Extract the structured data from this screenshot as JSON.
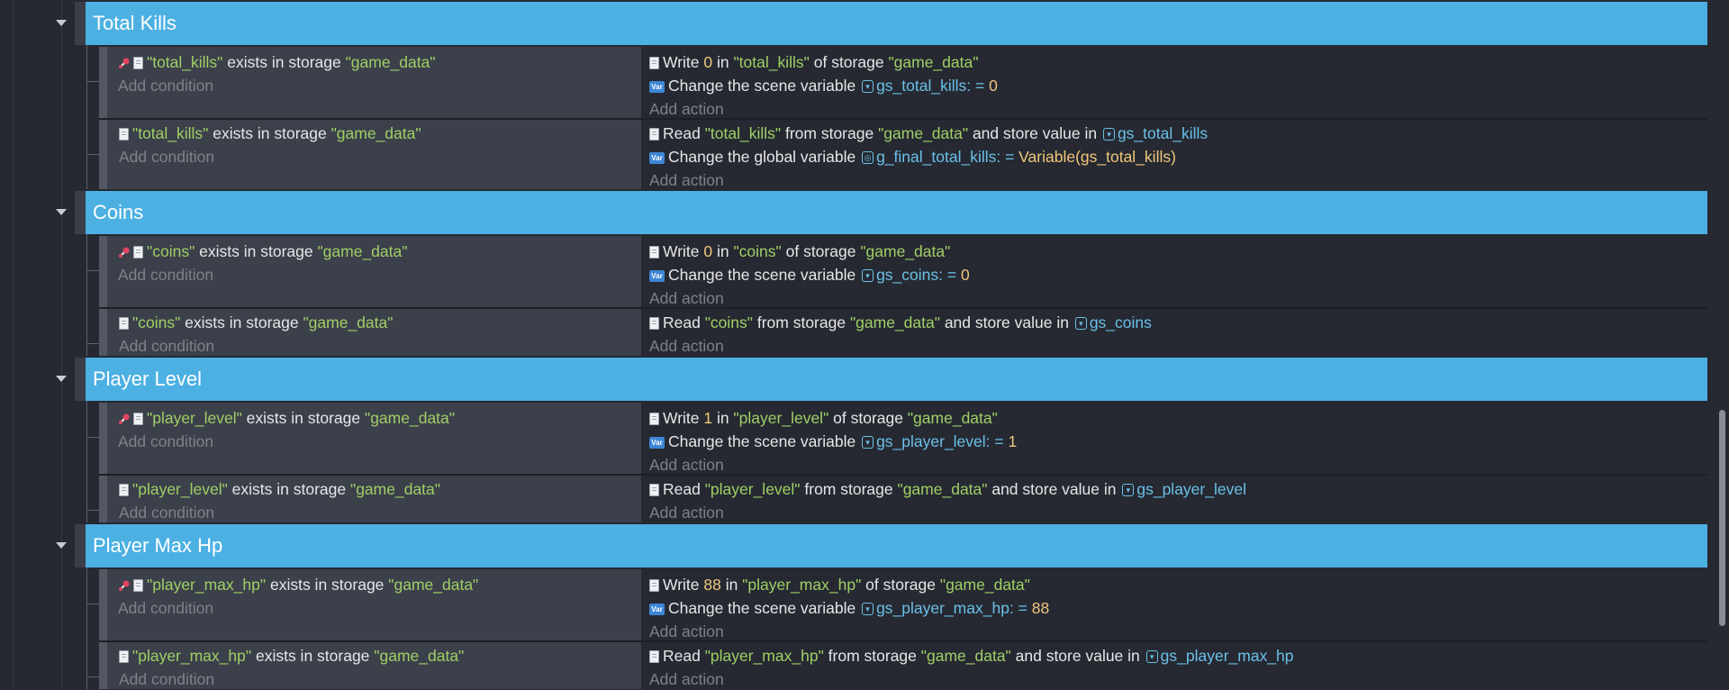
{
  "groups": [
    {
      "title": "Total Kills",
      "events": [
        {
          "conditions": [
            {
              "key": "\"total_kills\"",
              "mid": " exists in storage ",
              "storage": "\"game_data\""
            }
          ],
          "add_condition": "Add condition",
          "actions": [
            {
              "type": "write",
              "w_label": "Write ",
              "value": "0",
              "in": " in ",
              "key": "\"total_kills\"",
              "of": " of storage ",
              "storage": "\"game_data\""
            },
            {
              "type": "change",
              "label": "Change the scene variable ",
              "var": "gs_total_kills",
              "op": ": = ",
              "value": "0"
            }
          ],
          "add_action": "Add action"
        },
        {
          "conditions": [
            {
              "key": "\"total_kills\"",
              "mid": " exists in storage ",
              "storage": "\"game_data\""
            }
          ],
          "add_condition": "Add condition",
          "actions": [
            {
              "type": "read",
              "label": "Read ",
              "key": "\"total_kills\"",
              "from": " from storage ",
              "storage": "\"game_data\"",
              "store": " and store value in ",
              "var": "gs_total_kills"
            },
            {
              "type": "change-global",
              "label": "Change the global variable ",
              "var": "g_final_total_kills",
              "op": ": = ",
              "value": "Variable(gs_total_kills)"
            }
          ],
          "add_action": "Add action"
        }
      ]
    },
    {
      "title": "Coins",
      "events": [
        {
          "conditions": [
            {
              "key": "\"coins\"",
              "mid": " exists in storage ",
              "storage": "\"game_data\""
            }
          ],
          "add_condition": "Add condition",
          "actions": [
            {
              "type": "write",
              "w_label": "Write ",
              "value": "0",
              "in": " in ",
              "key": "\"coins\"",
              "of": " of storage ",
              "storage": "\"game_data\""
            },
            {
              "type": "change",
              "label": "Change the scene variable ",
              "var": "gs_coins",
              "op": ": = ",
              "value": "0"
            }
          ],
          "add_action": "Add action"
        },
        {
          "conditions": [
            {
              "key": "\"coins\"",
              "mid": " exists in storage ",
              "storage": "\"game_data\""
            }
          ],
          "add_condition": "Add condition",
          "actions": [
            {
              "type": "read",
              "label": "Read ",
              "key": "\"coins\"",
              "from": " from storage ",
              "storage": "\"game_data\"",
              "store": " and store value in ",
              "var": "gs_coins"
            }
          ],
          "add_action": "Add action"
        }
      ]
    },
    {
      "title": "Player Level",
      "events": [
        {
          "conditions": [
            {
              "key": "\"player_level\"",
              "mid": " exists in storage ",
              "storage": "\"game_data\""
            }
          ],
          "add_condition": "Add condition",
          "actions": [
            {
              "type": "write",
              "w_label": "Write ",
              "value": "1",
              "in": " in ",
              "key": "\"player_level\"",
              "of": " of storage ",
              "storage": "\"game_data\""
            },
            {
              "type": "change",
              "label": "Change the scene variable ",
              "var": "gs_player_level",
              "op": ": = ",
              "value": "1"
            }
          ],
          "add_action": "Add action"
        },
        {
          "conditions": [
            {
              "key": "\"player_level\"",
              "mid": " exists in storage ",
              "storage": "\"game_data\""
            }
          ],
          "add_condition": "Add condition",
          "actions": [
            {
              "type": "read",
              "label": "Read ",
              "key": "\"player_level\"",
              "from": " from storage ",
              "storage": "\"game_data\"",
              "store": " and store value in ",
              "var": "gs_player_level"
            }
          ],
          "add_action": "Add action"
        }
      ]
    },
    {
      "title": "Player Max Hp",
      "events": [
        {
          "conditions": [
            {
              "key": "\"player_max_hp\"",
              "mid": " exists in storage ",
              "storage": "\"game_data\""
            }
          ],
          "add_condition": "Add condition",
          "actions": [
            {
              "type": "write",
              "w_label": "Write ",
              "value": "88",
              "in": " in ",
              "key": "\"player_max_hp\"",
              "of": " of storage ",
              "storage": "\"game_data\""
            },
            {
              "type": "change",
              "label": "Change the scene variable ",
              "var": "gs_player_max_hp",
              "op": ": = ",
              "value": "88"
            }
          ],
          "add_action": "Add action"
        },
        {
          "conditions": [
            {
              "key": "\"player_max_hp\"",
              "mid": " exists in storage ",
              "storage": "\"game_data\""
            }
          ],
          "add_condition": "Add condition",
          "actions": [
            {
              "type": "read",
              "label": "Read ",
              "key": "\"player_max_hp\"",
              "from": " from storage ",
              "storage": "\"game_data\"",
              "store": " and store value in ",
              "var": "gs_player_max_hp"
            }
          ],
          "add_action": "Add action"
        }
      ]
    }
  ]
}
